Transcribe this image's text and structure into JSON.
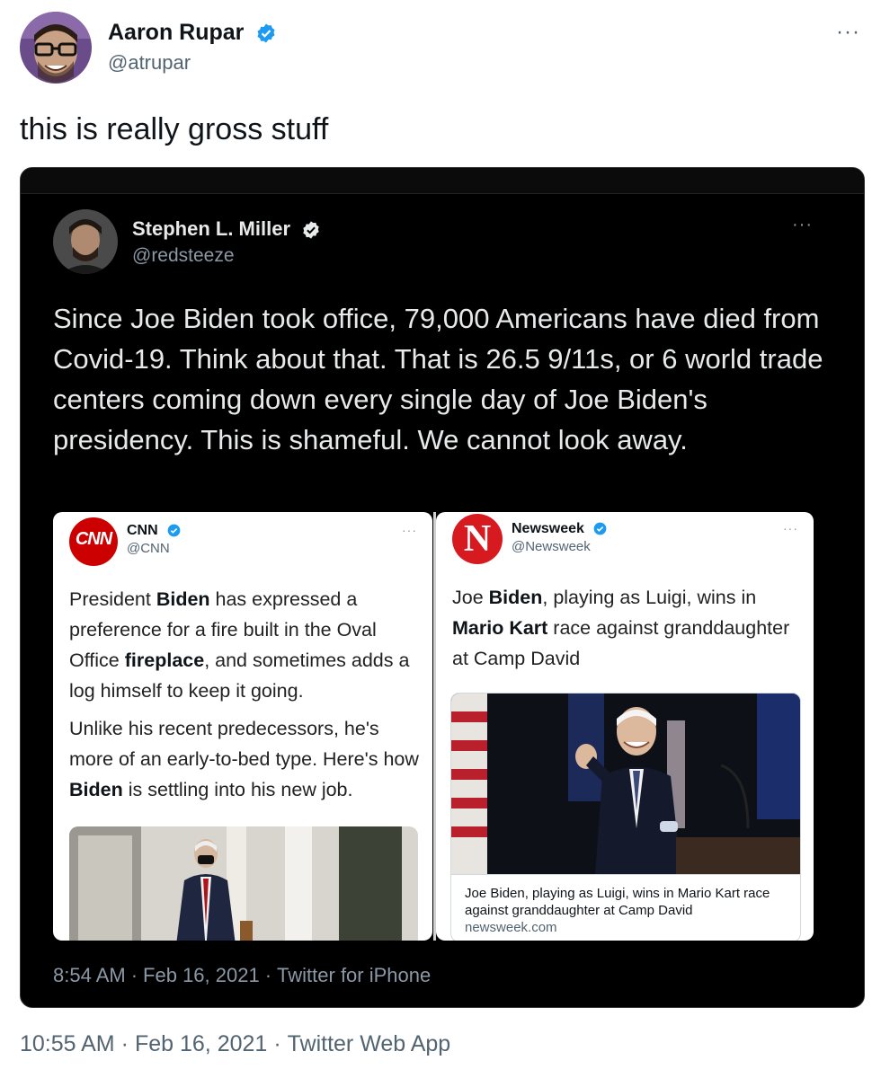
{
  "outer_tweet": {
    "author_name": "Aaron Rupar",
    "author_handle": "@atrupar",
    "text": "this is really gross stuff",
    "more": "···",
    "timestamp": {
      "time": "10:55 AM",
      "date": "Feb 16, 2021",
      "source": "Twitter Web App"
    }
  },
  "quoted_tweet": {
    "author_name": "Stephen L. Miller",
    "author_handle": "@redsteeze",
    "more": "···",
    "text": "Since Joe Biden took office, 79,000 Americans have died from Covid-19. Think about that. That is 26.5 9/11s, or 6 world trade centers coming down every single day of Joe Biden's presidency. This is shameful. We cannot look away.",
    "timestamp": {
      "time": "8:54 AM",
      "date": "Feb 16, 2021",
      "source": "Twitter for iPhone"
    }
  },
  "cnn_card": {
    "name": "CNN",
    "handle": "@CNN",
    "logo_text": "CNN",
    "more": "···",
    "p1": [
      "President ",
      "Biden",
      " has expressed a preference for a fire built in the Oval Office ",
      "fireplace",
      ", and sometimes adds a log himself to keep it going."
    ],
    "p2": [
      "Unlike his recent predecessors, he's more of an early-to-bed type. Here's how ",
      "Biden",
      " is settling into his new job."
    ]
  },
  "newsweek_card": {
    "name": "Newsweek",
    "handle": "@Newsweek",
    "logo_text": "N",
    "more": "···",
    "p1": [
      "Joe ",
      "Biden",
      ", playing as Luigi, wins in ",
      "Mario Kart",
      " race against granddaughter at Camp David"
    ],
    "link_title": "Joe Biden, playing as Luigi, wins in Mario Kart race against granddaughter at Camp David",
    "link_domain": "newsweek.com"
  },
  "colors": {
    "verified_blue": "#1d9bf0",
    "cnn_red": "#cc0000",
    "newsweek_red": "#d71920",
    "dark_bg": "#000000"
  }
}
